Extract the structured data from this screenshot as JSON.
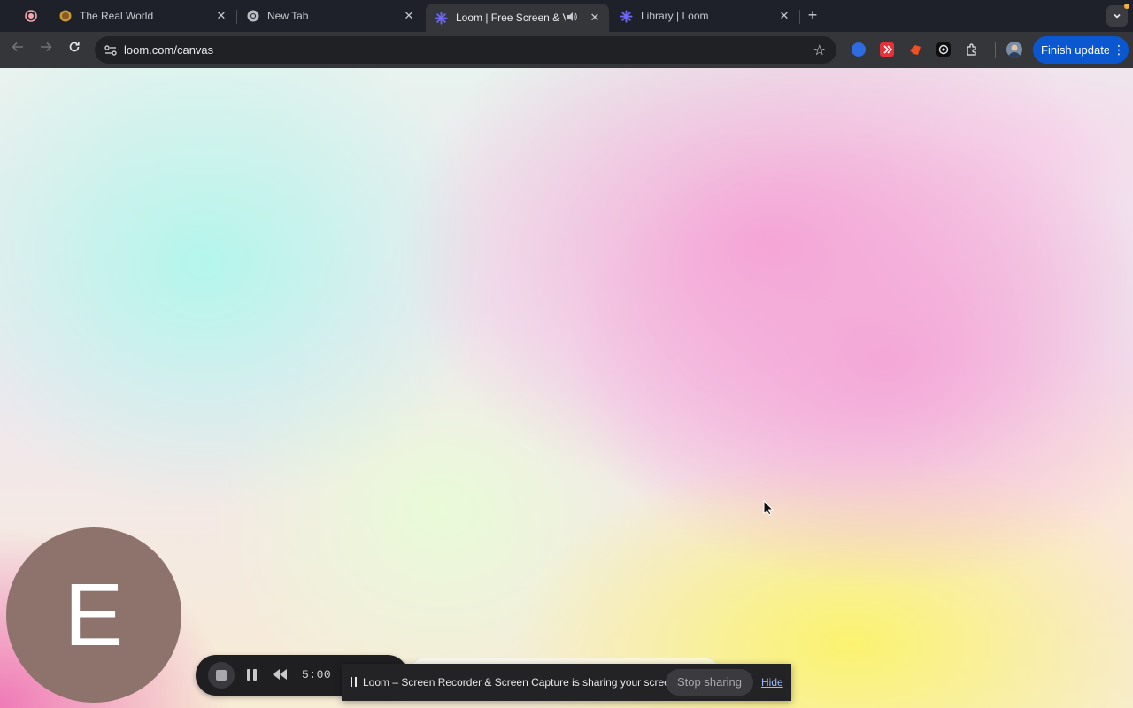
{
  "tabs": [
    {
      "title": "The Real World",
      "favicon": "gold-coin-icon",
      "active": false
    },
    {
      "title": "New Tab",
      "favicon": "chrome-icon",
      "active": false
    },
    {
      "title": "Loom | Free Screen & Vide",
      "favicon": "loom-icon",
      "active": true,
      "audio": true
    },
    {
      "title": "Library | Loom",
      "favicon": "loom-icon",
      "active": false
    }
  ],
  "tab_close_symbol": "✕",
  "new_tab_symbol": "+",
  "address_bar": {
    "url": "loom.com/canvas"
  },
  "toolbar": {
    "finish_update_label": "Finish update"
  },
  "camera": {
    "initial": "E",
    "bubble_color": "#8e736c"
  },
  "recording": {
    "timer": "5:00"
  },
  "sharing_banner": {
    "text": "Loom – Screen Recorder & Screen Capture is sharing your screen.",
    "stop_label": "Stop sharing",
    "hide_label": "Hide"
  },
  "colors": {
    "accent": "#0b57d0",
    "tab_bar": "#1e2129",
    "toolbar": "#35363a"
  }
}
